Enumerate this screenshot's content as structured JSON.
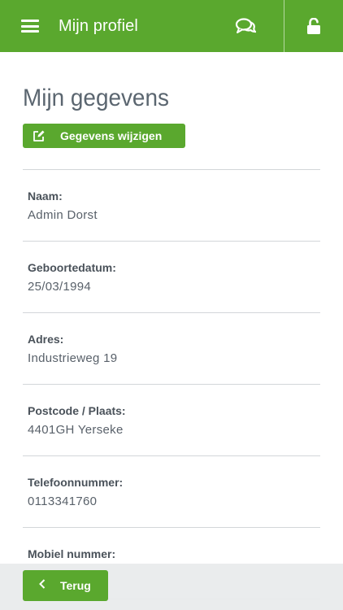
{
  "header": {
    "title": "Mijn profiel",
    "menu_icon": "hamburger-icon",
    "chat_icon": "chat-bubbles-icon",
    "lock_icon": "unlock-icon",
    "color": "#5aa82e"
  },
  "main": {
    "title": "Mijn gegevens",
    "edit_button": "Gegevens wijzigen",
    "fields": [
      {
        "label": "Naam:",
        "value": "Admin Dorst"
      },
      {
        "label": "Geboortedatum:",
        "value": "25/03/1994"
      },
      {
        "label": "Adres:",
        "value": "Industrieweg 19"
      },
      {
        "label": "Postcode / Plaats:",
        "value": "4401GH Yerseke"
      },
      {
        "label": "Telefoonnummer:",
        "value": "0113341760"
      },
      {
        "label": "Mobiel nummer:",
        "value": ""
      }
    ]
  },
  "footer": {
    "back_button": "Terug",
    "back_icon": "chevron-left-icon"
  }
}
